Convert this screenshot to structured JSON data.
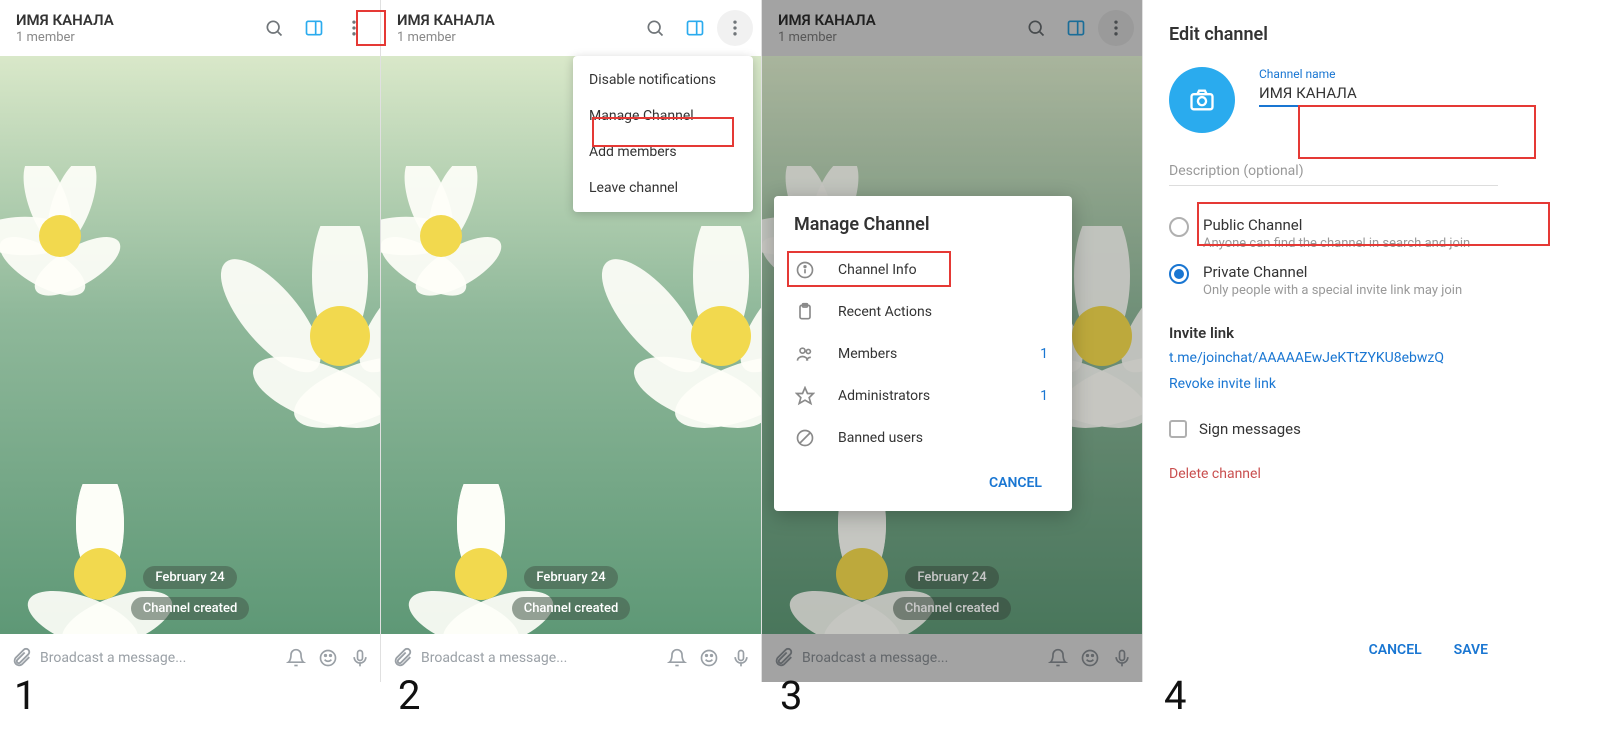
{
  "channel": {
    "name": "ИМЯ КАНАЛА",
    "members": "1 member"
  },
  "chat": {
    "date": "February 24",
    "created": "Channel created",
    "placeholder": "Broadcast a message..."
  },
  "dropdown": {
    "disable": "Disable notifications",
    "manage": "Manage Channel",
    "add": "Add members",
    "leave": "Leave channel"
  },
  "manage": {
    "title": "Manage Channel",
    "info": "Channel Info",
    "recent": "Recent Actions",
    "members": "Members",
    "members_n": "1",
    "admins": "Administrators",
    "admins_n": "1",
    "banned": "Banned users",
    "cancel": "CANCEL"
  },
  "edit": {
    "title": "Edit channel",
    "name_label": "Channel name",
    "name_value": "ИМЯ КАНАЛА",
    "desc_placeholder": "Description (optional)",
    "public": {
      "title": "Public Channel",
      "desc": "Anyone can find the channel in search and join"
    },
    "private": {
      "title": "Private Channel",
      "desc": "Only people with a special invite link may join"
    },
    "invite_label": "Invite link",
    "invite_url": "t.me/joinchat/AAAAAEwJeKTtZYKU8ebwzQ",
    "revoke": "Revoke invite link",
    "sign": "Sign messages",
    "delete": "Delete channel",
    "cancel": "CANCEL",
    "save": "SAVE"
  },
  "steps": {
    "s1": "1",
    "s2": "2",
    "s3": "3",
    "s4": "4"
  }
}
